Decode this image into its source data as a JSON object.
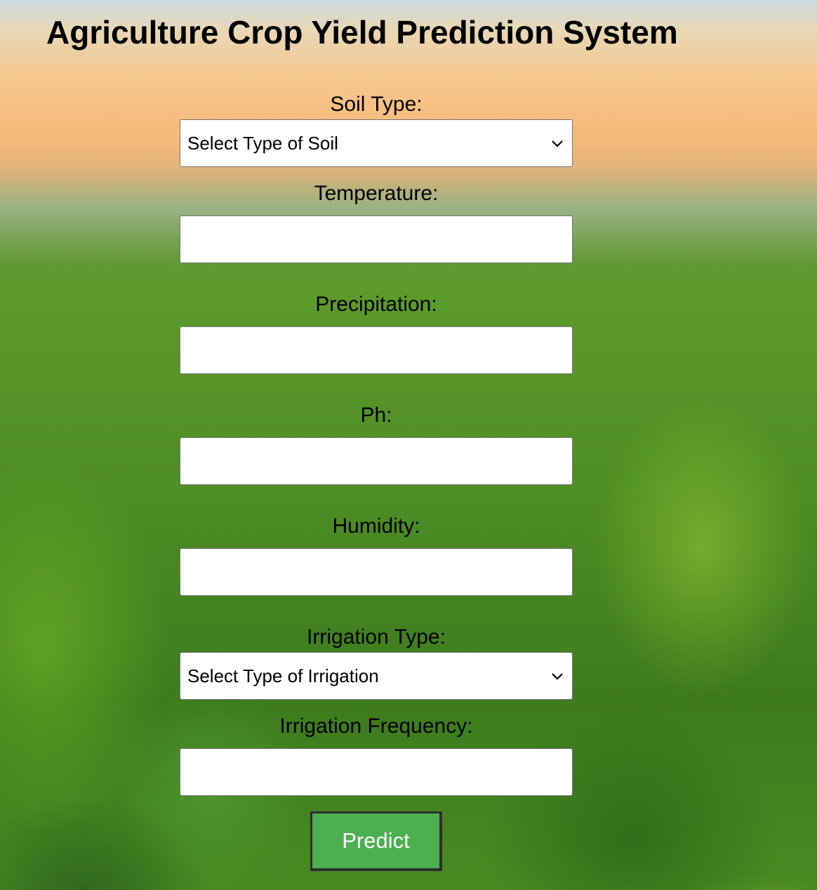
{
  "page": {
    "title": "Agriculture Crop Yield Prediction System",
    "background": "blurred green crop field under an orange sunset sky"
  },
  "form": {
    "soil_type": {
      "label": "Soil Type:",
      "selected": "Select Type of Soil"
    },
    "temperature": {
      "label": "Temperature:",
      "value": ""
    },
    "precipitation": {
      "label": "Precipitation:",
      "value": ""
    },
    "ph": {
      "label": "Ph:",
      "value": ""
    },
    "humidity": {
      "label": "Humidity:",
      "value": ""
    },
    "irrigation_type": {
      "label": "Irrigation Type:",
      "selected": "Select Type of Irrigation"
    },
    "irrigation_frequency": {
      "label": "Irrigation Frequency:",
      "value": ""
    },
    "submit_label": "Predict"
  },
  "icons": {
    "select_arrow": "chevron-down-icon"
  },
  "colors": {
    "predict_button": "#4caf50",
    "predict_text": "#ffffff",
    "field_background": "#ffffff",
    "title_text": "#000000"
  }
}
